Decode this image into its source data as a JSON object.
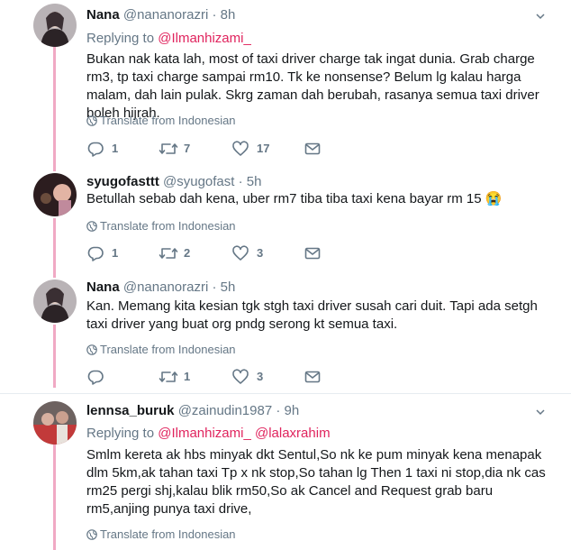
{
  "tweets": [
    {
      "name": "Nana",
      "handle": "@nananorazri",
      "time": "· 8h",
      "reply_label": "Replying to",
      "reply_mentions": [
        "@Ilmanhizami_"
      ],
      "text": "Bukan nak kata lah, most of taxi driver charge tak ingat dunia. Grab charge rm3, tp taxi charge sampai rm10. Tk ke nonsense? Belum lg kalau harga malam, dah lain pulak. Skrg zaman dah berubah, rasanya semua taxi driver boleh hijrah.",
      "translate": "Translate from Indonesian",
      "replies": "1",
      "retweets": "7",
      "likes": "17"
    },
    {
      "name": "syugofasttt",
      "handle": "@syugofast",
      "time": "· 5h",
      "text": "Betullah sebab dah kena, uber rm7 tiba tiba taxi kena bayar rm 15 😭",
      "translate": "Translate from Indonesian",
      "replies": "1",
      "retweets": "2",
      "likes": "3"
    },
    {
      "name": "Nana",
      "handle": "@nananorazri",
      "time": "· 5h",
      "text": "Kan. Memang kita kesian tgk stgh taxi driver susah cari duit. Tapi ada setgh taxi driver yang buat org pndg serong kt semua taxi.",
      "translate": "Translate from Indonesian",
      "replies": "",
      "retweets": "1",
      "likes": "3"
    },
    {
      "name": "lennsa_buruk",
      "handle": "@zainudin1987",
      "time": "· 9h",
      "reply_label": "Replying to",
      "reply_mentions": [
        "@Ilmanhizami_",
        "@lalaxrahim"
      ],
      "text": "Smlm kereta ak hbs minyak dkt Sentul,So nk ke pum minyak kena menapak dlm 5km,ak tahan taxi Tp x nk stop,So tahan lg Then 1 taxi ni stop,dia nk cas rm25 pergi shj,kalau blik rm50,So ak Cancel and Request grab baru rm5,anjing punya taxi drive,",
      "translate": "Translate from Indonesian"
    }
  ],
  "colors": {
    "thread_line": "#f0a9c4",
    "mention": "#e0245e",
    "muted": "#657786"
  },
  "icons": {
    "reply": "reply-icon",
    "retweet": "retweet-icon",
    "like": "heart-icon",
    "dm": "envelope-icon",
    "globe": "globe-icon",
    "caret": "chevron-down-icon"
  }
}
